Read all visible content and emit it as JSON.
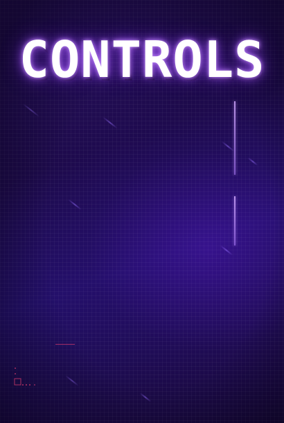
{
  "screen": {
    "title": "CONTROLS"
  },
  "colors": {
    "background": "#1c0a48",
    "title_text": "#ffffff",
    "title_glow": "#aa5aff",
    "divider": "#c8a0ff",
    "hud_accent": "#dc3c6e"
  }
}
